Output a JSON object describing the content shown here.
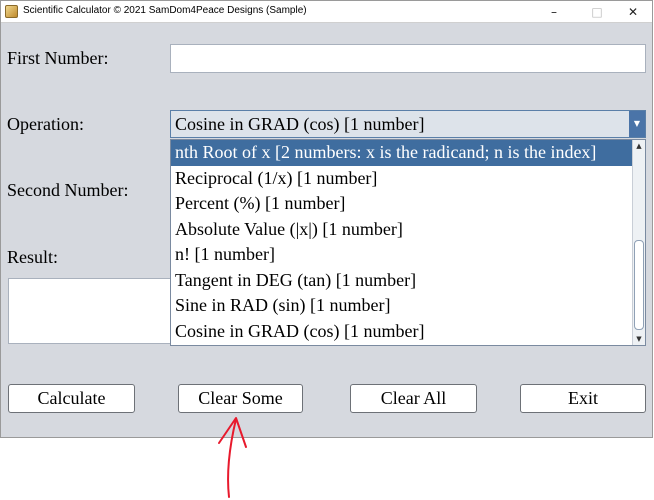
{
  "window": {
    "title": "Scientific Calculator © 2021 SamDom4Peace Designs (Sample)",
    "controls": {
      "minimize": "–",
      "maximize": "□",
      "close": "✕"
    }
  },
  "form": {
    "first_number_label": "First Number:",
    "first_number_value": "",
    "operation_label": "Operation:",
    "operation_selected": "Cosine in GRAD (cos) [1 number]",
    "second_number_label": "Second Number:",
    "result_label": "Result:"
  },
  "dropdown": {
    "items": [
      "nth Root of x [2 numbers: x is the radicand; n is the index]",
      "Reciprocal (1/x) [1 number]",
      "Percent (%) [1 number]",
      "Absolute Value (|x|) [1 number]",
      "n! [1 number]",
      "Tangent in DEG (tan) [1 number]",
      "Sine in RAD (sin) [1 number]",
      "Cosine in GRAD (cos) [1 number]"
    ],
    "highlighted_index": 0
  },
  "buttons": {
    "calculate": "Calculate",
    "clear_some": "Clear Some",
    "clear_all": "Clear All",
    "exit": "Exit"
  },
  "annotation": {
    "color": "#e8192c",
    "icon": "red-arrow-pointing-up"
  },
  "colors": {
    "selection": "#3f6d9f",
    "window_bg": "#d6d9df"
  }
}
